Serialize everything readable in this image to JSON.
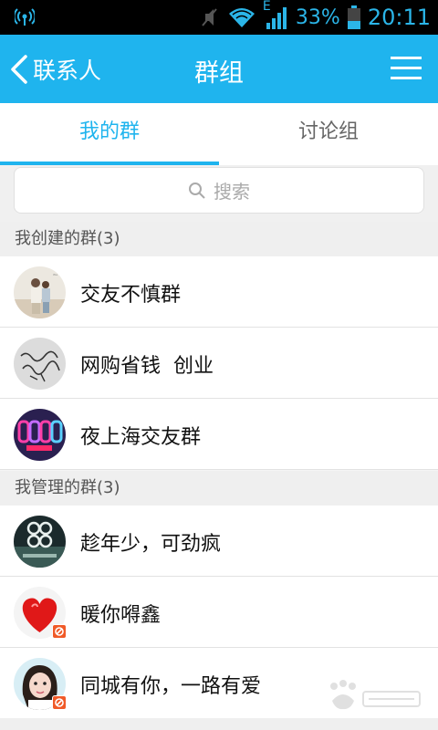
{
  "status_bar": {
    "battery_percent": "33%",
    "time": "20:11",
    "network_label": "E",
    "icons": [
      "signal-broadcast-icon",
      "mute-icon",
      "wifi-icon",
      "cell-signal-icon",
      "battery-icon"
    ]
  },
  "title_bar": {
    "back_label": "联系人",
    "title": "群组",
    "menu_icon": "menu-icon"
  },
  "tabs": [
    {
      "label": "我的群",
      "active": true
    },
    {
      "label": "讨论组",
      "active": false
    }
  ],
  "search": {
    "placeholder": "搜索",
    "icon": "search-icon"
  },
  "sections": [
    {
      "header": "我创建的群(3)",
      "groups": [
        {
          "name": "交友不慎群",
          "badge": false
        },
        {
          "name": "网购省钱  创业",
          "badge": false
        },
        {
          "name": "夜上海交友群",
          "badge": false
        }
      ]
    },
    {
      "header": "我管理的群(3)",
      "groups": [
        {
          "name": "趁年少，可劲疯",
          "badge": false
        },
        {
          "name": "暖你嘚鑫",
          "badge": true
        },
        {
          "name": "同城有你，一路有爱",
          "badge": true
        }
      ]
    }
  ],
  "colors": {
    "accent": "#1fb4ee",
    "status_bar_bg": "#000000",
    "badge": "#f05a28"
  }
}
